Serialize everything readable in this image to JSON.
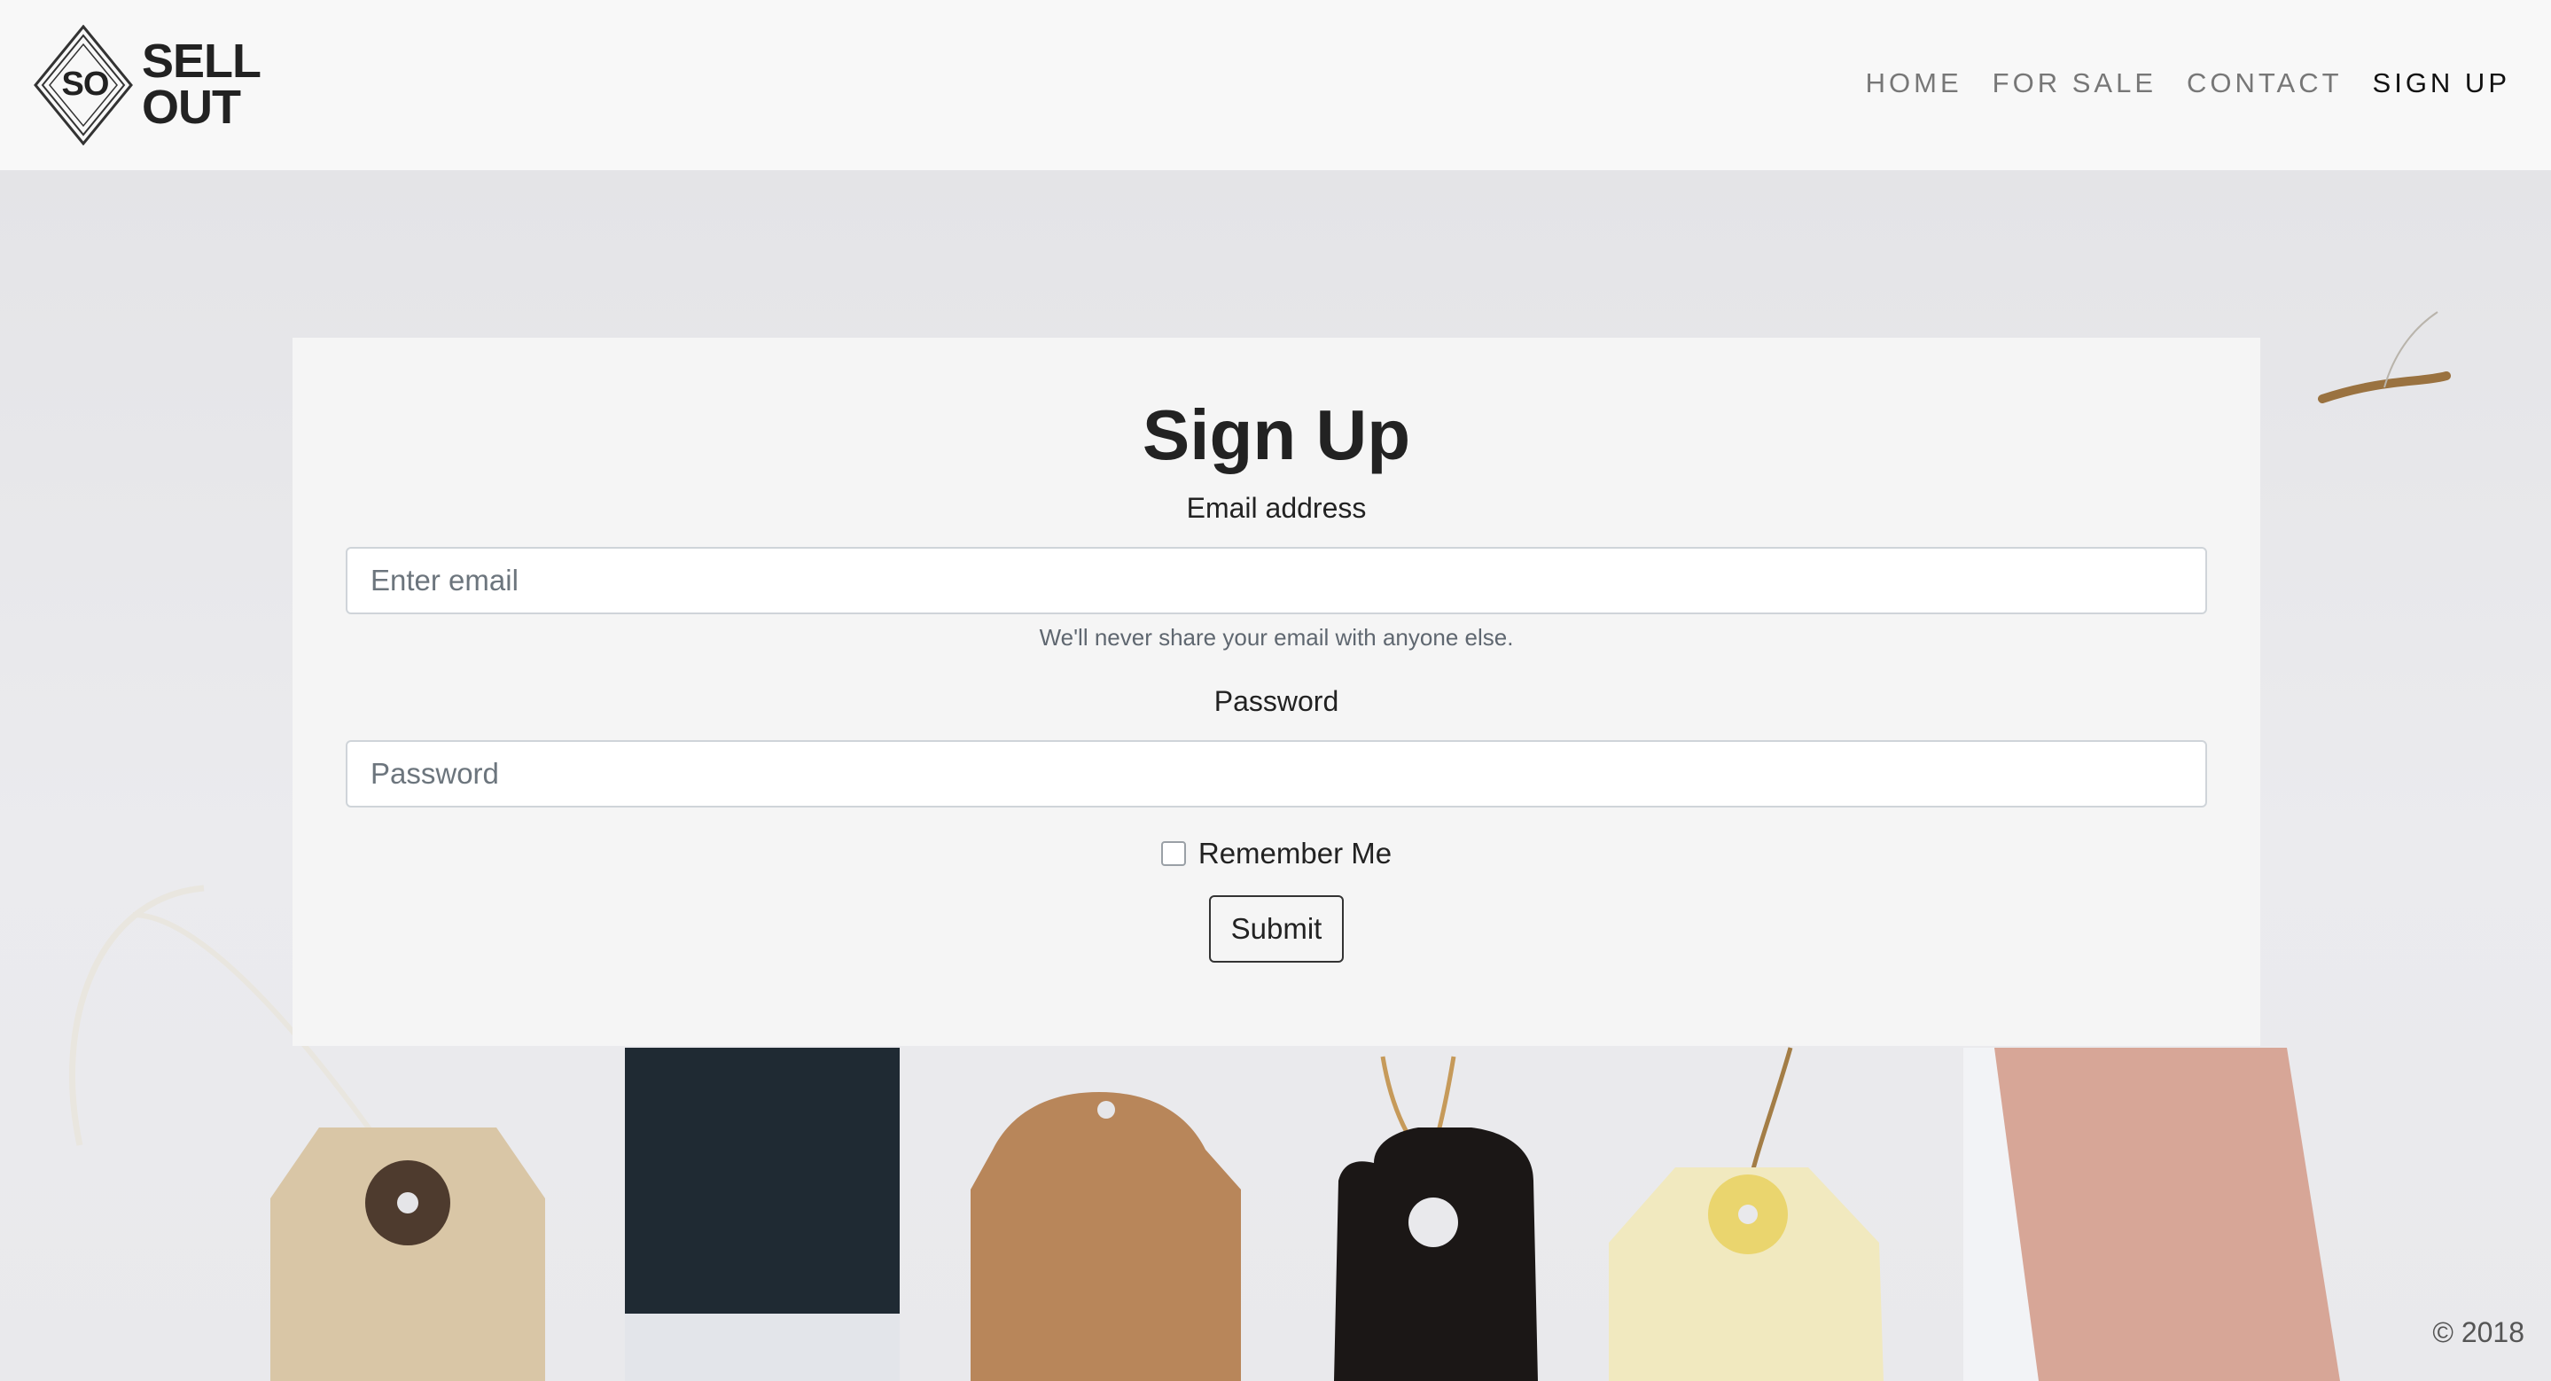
{
  "brand": {
    "mark": "SO",
    "line1": "SELL",
    "line2": "OUT"
  },
  "nav": {
    "items": [
      {
        "label": "HOME",
        "active": false
      },
      {
        "label": "FOR SALE",
        "active": false
      },
      {
        "label": "CONTACT",
        "active": false
      },
      {
        "label": "SIGN UP",
        "active": true
      }
    ]
  },
  "form": {
    "title": "Sign Up",
    "email_label": "Email address",
    "email_placeholder": "Enter email",
    "email_value": "",
    "email_help": "We'll never share your email with anyone else.",
    "password_label": "Password",
    "password_placeholder": "Password",
    "password_value": "",
    "remember_label": "Remember Me",
    "remember_checked": false,
    "submit_label": "Submit"
  },
  "footer": {
    "copyright": "© 2018"
  },
  "background": {
    "subject": "assorted blank gift tags with strings",
    "tag_colors": [
      "#d9c6a6",
      "#1f2a33",
      "#b8865a",
      "#1b1716",
      "#f1e9bf",
      "#d7a697"
    ]
  }
}
